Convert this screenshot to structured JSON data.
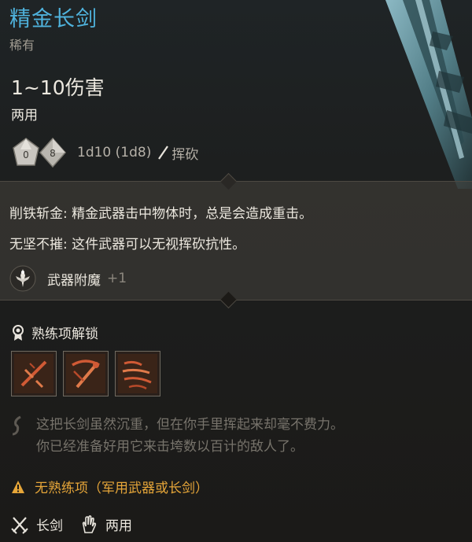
{
  "item": {
    "name": "精金长剑",
    "rarity": "稀有",
    "damage": "1~10伤害",
    "handedness": "两用"
  },
  "dice": {
    "die1_label": "0",
    "die2_label": "8",
    "formula": "1d10 (1d8)",
    "damage_type": "挥砍"
  },
  "properties": [
    {
      "text": "削铁斩金: 精金武器击中物体时，总是会造成重击。"
    },
    {
      "text": "无坚不摧: 这件武器可以无视挥砍抗性。"
    }
  ],
  "enchantment": {
    "label": "武器附魔",
    "value": "+1"
  },
  "proficiency": {
    "header": "熟练项解锁",
    "actions": [
      {
        "icon": "lacerate-action-icon"
      },
      {
        "icon": "pommel-strike-action-icon"
      },
      {
        "icon": "cleave-action-icon"
      }
    ]
  },
  "flavor": {
    "line1": "这把长剑虽然沉重，但在你手里挥起来却毫不费力。",
    "line2": "你已经准备好用它来击垮数以百计的敌人了。"
  },
  "warning": {
    "text": "无熟练项（军用武器或长剑）"
  },
  "footer": {
    "weapon_type": "长剑",
    "grip": "两用"
  },
  "colors": {
    "title": "#4fb2dc",
    "warning": "#e6a639",
    "action_glyph": "#d05a35"
  }
}
